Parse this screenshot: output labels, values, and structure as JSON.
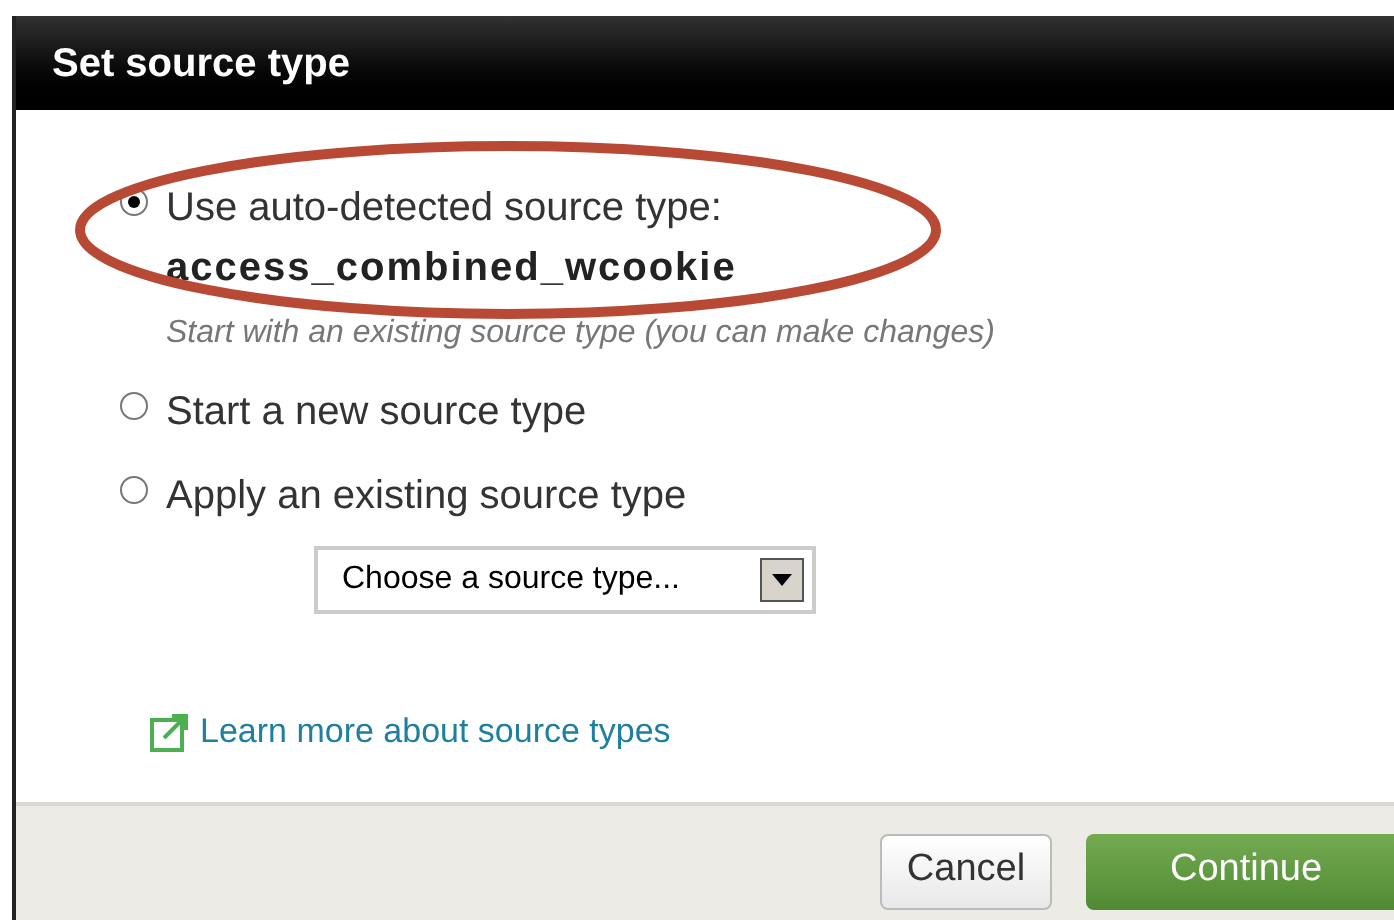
{
  "dialog": {
    "title": "Set source type"
  },
  "options": [
    {
      "kind": "detected",
      "label": "Use auto-detected source type:",
      "value": "access_combined_wcookie",
      "hint": "Start with an existing source type (you can make changes)",
      "selected": true,
      "highlighted": true
    },
    {
      "kind": "plain",
      "label": "Start a new source type",
      "selected": false,
      "highlighted": false
    },
    {
      "kind": "select",
      "label": "Apply an existing source type",
      "select": {
        "value": "Choose a source type..."
      },
      "selected": false,
      "highlighted": false
    }
  ],
  "link": "Learn more about source types",
  "buttons": [
    {
      "kind": "secondary",
      "label": "Cancel"
    },
    {
      "kind": "primary",
      "label": "Continue"
    }
  ]
}
